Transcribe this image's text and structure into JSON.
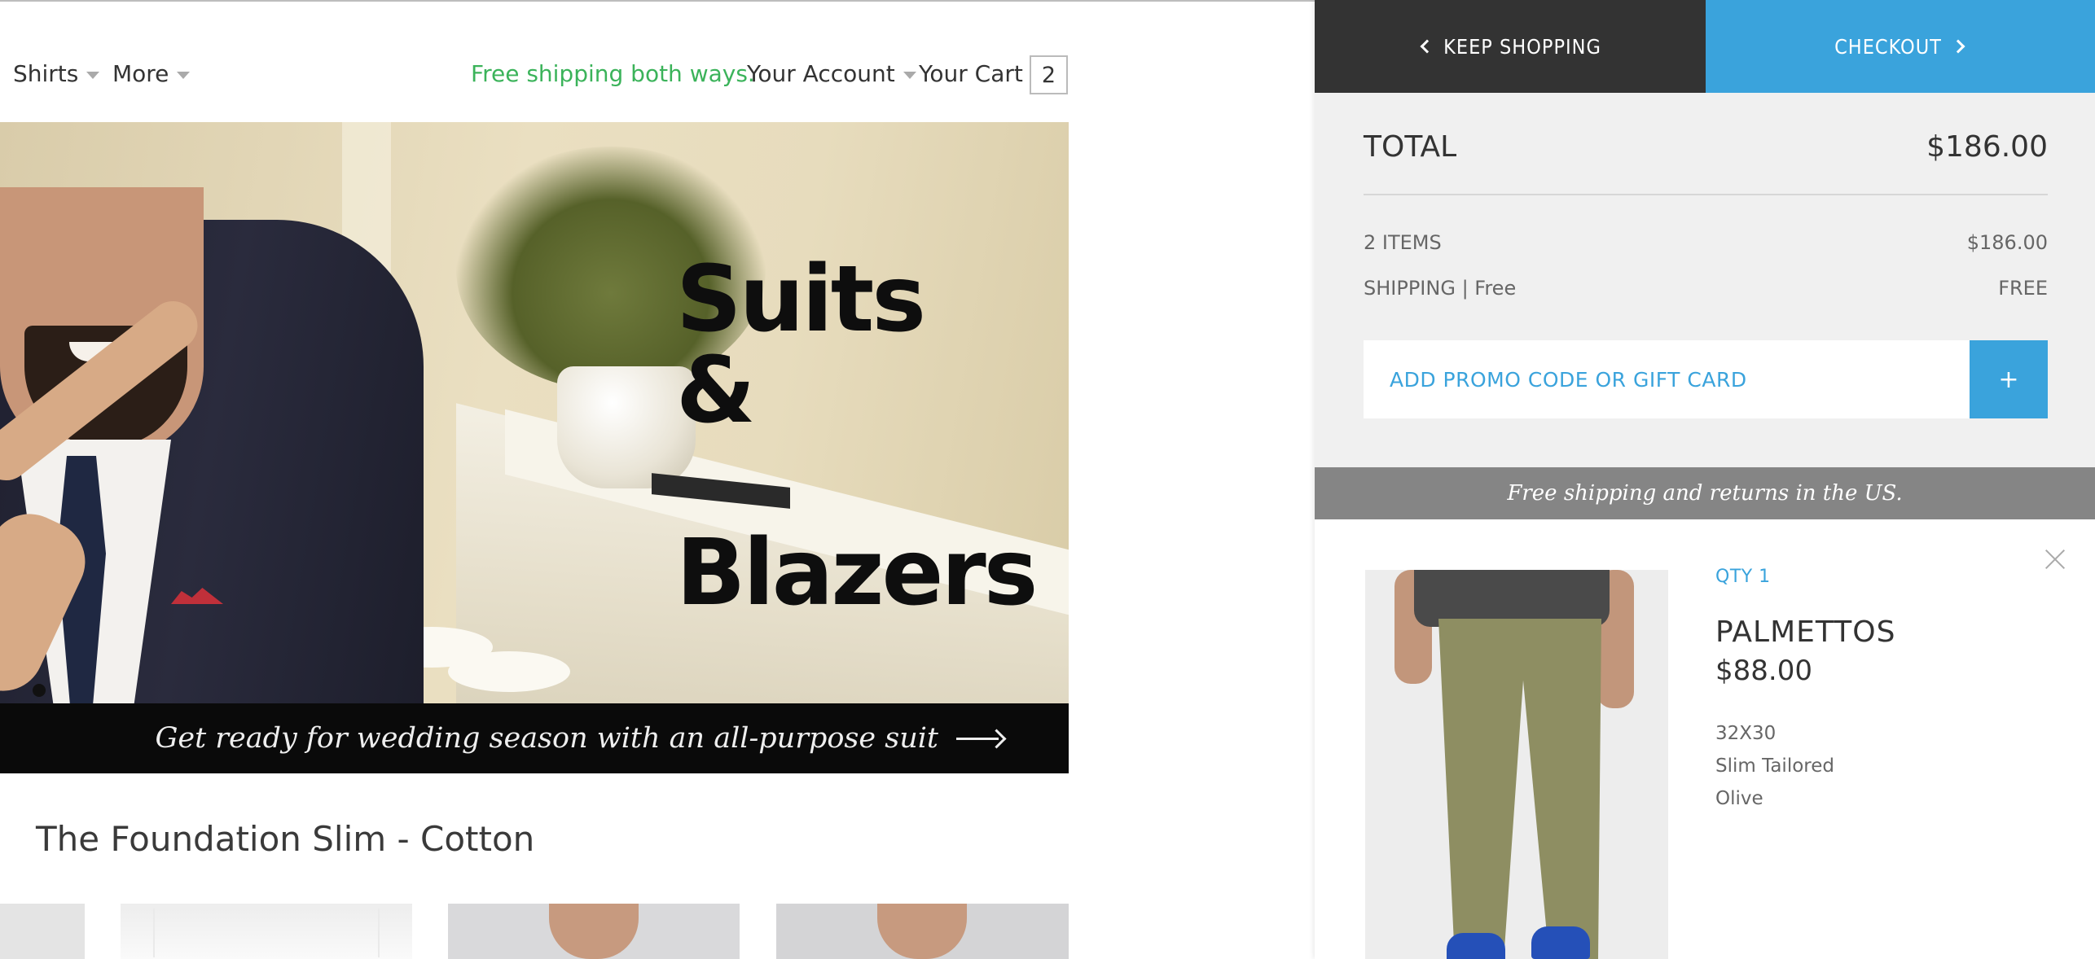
{
  "nav": {
    "items": [
      {
        "label": "Shirts"
      },
      {
        "label": "More"
      }
    ],
    "promo_text": "Free shipping both ways.",
    "account_label": "Your Account",
    "cart_label": "Your Cart",
    "cart_count": "2",
    "promo_color": "#3bb35a"
  },
  "hero": {
    "title_line1": "Suits &",
    "title_line2": "Blazers",
    "banner_text": "Get ready for wedding season with an all-purpose suit",
    "banner_icon": "arrow-right-icon"
  },
  "main": {
    "section_title": "The Foundation Slim - Cotton"
  },
  "cart": {
    "keep_shopping_label": "KEEP SHOPPING",
    "checkout_label": "CHECKOUT",
    "total_label": "TOTAL",
    "total_value": "$186.00",
    "items_label": "2 ITEMS",
    "items_value": "$186.00",
    "shipping_label": "SHIPPING | Free",
    "shipping_value": "FREE",
    "promo_label": "ADD PROMO CODE OR GIFT CARD",
    "promo_button": "+",
    "shipping_banner": "Free shipping and returns in the US.",
    "accent_color": "#3aa3dc",
    "dark_color": "#333333",
    "item": {
      "qty": "QTY 1",
      "name": "PALMETTOS",
      "price": "$88.00",
      "size": "32X30",
      "fit": "Slim Tailored",
      "color": "Olive"
    }
  }
}
